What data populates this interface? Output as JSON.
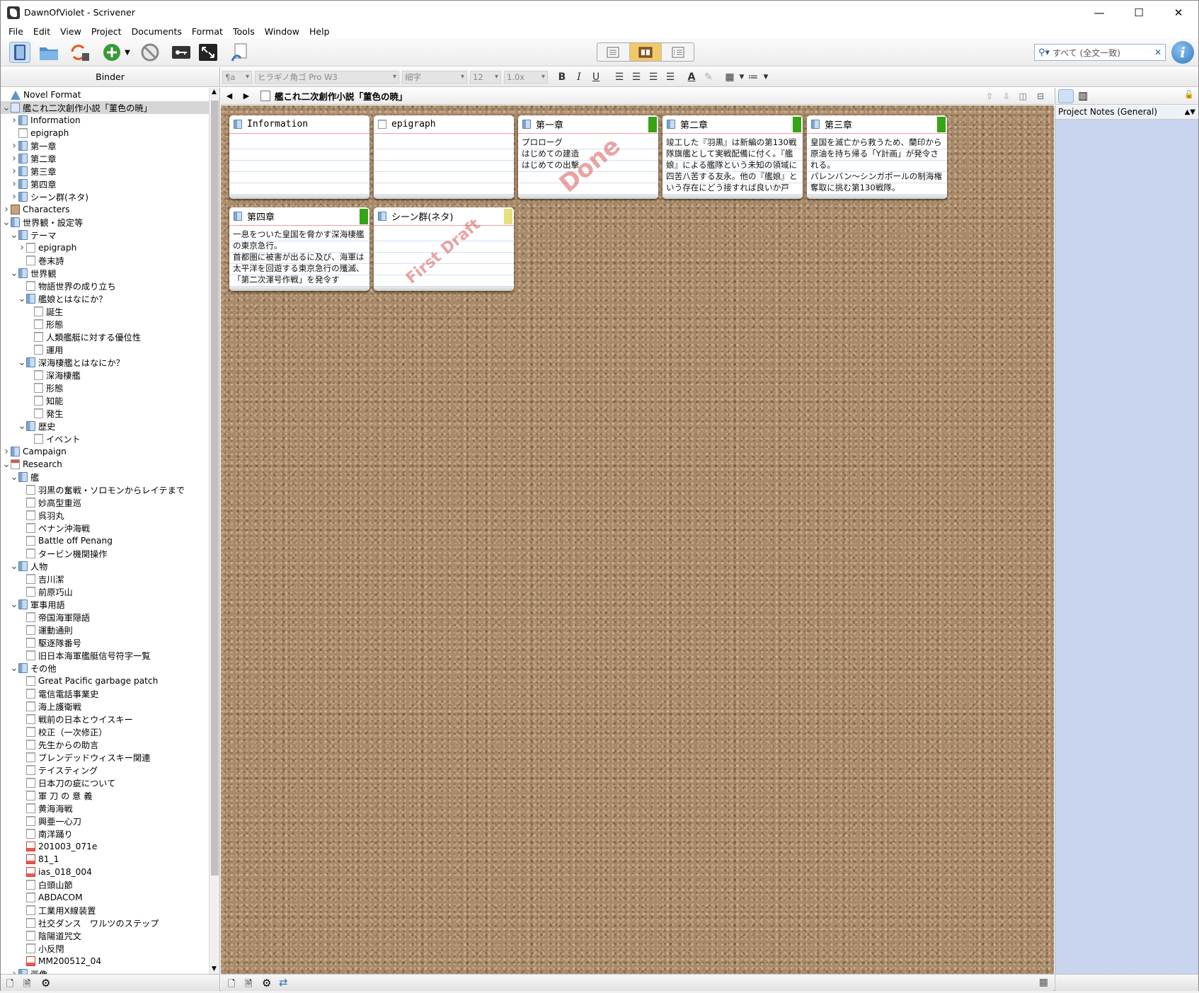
{
  "window": {
    "title": "DawnOfViolet - Scrivener",
    "minimize": "—",
    "maximize": "☐",
    "close": "✕"
  },
  "menu": [
    "File",
    "Edit",
    "View",
    "Project",
    "Documents",
    "Format",
    "Tools",
    "Window",
    "Help"
  ],
  "toolbar": {
    "search_placeholder": "すべて (全文一致)",
    "info": "i"
  },
  "binder": {
    "header": "Binder",
    "items": [
      {
        "label": "Novel Format",
        "level": 0,
        "icon": "warn",
        "arrow": ""
      },
      {
        "label": "艦これ二次創作小説「菫色の暁」",
        "level": 0,
        "icon": "draft",
        "arrow": "v",
        "selected": true
      },
      {
        "label": "Information",
        "level": 1,
        "icon": "folder",
        "arrow": ">"
      },
      {
        "label": "epigraph",
        "level": 1,
        "icon": "doc",
        "arrow": ""
      },
      {
        "label": "第一章",
        "level": 1,
        "icon": "folder",
        "arrow": ">"
      },
      {
        "label": "第二章",
        "level": 1,
        "icon": "folder",
        "arrow": ">"
      },
      {
        "label": "第三章",
        "level": 1,
        "icon": "folder",
        "arrow": ">"
      },
      {
        "label": "第四章",
        "level": 1,
        "icon": "folder",
        "arrow": ">"
      },
      {
        "label": "シーン群(ネタ)",
        "level": 1,
        "icon": "folder",
        "arrow": ">"
      },
      {
        "label": "Characters",
        "level": 0,
        "icon": "chars",
        "arrow": ">"
      },
      {
        "label": "世界観・設定等",
        "level": 0,
        "icon": "folder",
        "arrow": "v"
      },
      {
        "label": "テーマ",
        "level": 1,
        "icon": "folder",
        "arrow": "v"
      },
      {
        "label": "epigraph",
        "level": 2,
        "icon": "doc",
        "arrow": ">"
      },
      {
        "label": "巻末詩",
        "level": 2,
        "icon": "doc",
        "arrow": ""
      },
      {
        "label": "世界観",
        "level": 1,
        "icon": "folder",
        "arrow": "v"
      },
      {
        "label": "物語世界の成り立ち",
        "level": 2,
        "icon": "doc",
        "arrow": ""
      },
      {
        "label": "艦娘とはなにか？",
        "level": 2,
        "icon": "folder",
        "arrow": "v"
      },
      {
        "label": "誕生",
        "level": 3,
        "icon": "doc",
        "arrow": ""
      },
      {
        "label": "形態",
        "level": 3,
        "icon": "doc",
        "arrow": ""
      },
      {
        "label": "人類艦艇に対する優位性",
        "level": 3,
        "icon": "doc",
        "arrow": ""
      },
      {
        "label": "運用",
        "level": 3,
        "icon": "doc",
        "arrow": ""
      },
      {
        "label": "深海棲艦とはなにか？",
        "level": 2,
        "icon": "folder",
        "arrow": "v"
      },
      {
        "label": "深海棲艦",
        "level": 3,
        "icon": "doc",
        "arrow": ""
      },
      {
        "label": "形態",
        "level": 3,
        "icon": "doc",
        "arrow": ""
      },
      {
        "label": "知能",
        "level": 3,
        "icon": "doc",
        "arrow": ""
      },
      {
        "label": "発生",
        "level": 3,
        "icon": "doc",
        "arrow": ""
      },
      {
        "label": "歴史",
        "level": 2,
        "icon": "folder",
        "arrow": "v"
      },
      {
        "label": "イベント",
        "level": 3,
        "icon": "doc",
        "arrow": ""
      },
      {
        "label": "Campaign",
        "level": 0,
        "icon": "folder",
        "arrow": ">"
      },
      {
        "label": "Research",
        "level": 0,
        "icon": "research",
        "arrow": "v"
      },
      {
        "label": "艦",
        "level": 1,
        "icon": "folder",
        "arrow": "v"
      },
      {
        "label": "羽黒の奮戦・ソロモンからレイテまで",
        "level": 2,
        "icon": "doc",
        "arrow": ""
      },
      {
        "label": "妙高型重巡",
        "level": 2,
        "icon": "doc",
        "arrow": ""
      },
      {
        "label": "呉羽丸",
        "level": 2,
        "icon": "doc",
        "arrow": ""
      },
      {
        "label": "ペナン沖海戦",
        "level": 2,
        "icon": "doc",
        "arrow": ""
      },
      {
        "label": "Battle off Penang",
        "level": 2,
        "icon": "doc",
        "arrow": ""
      },
      {
        "label": "タービン機関操作",
        "level": 2,
        "icon": "doc",
        "arrow": ""
      },
      {
        "label": "人物",
        "level": 1,
        "icon": "folder",
        "arrow": "v"
      },
      {
        "label": "吉川潔",
        "level": 2,
        "icon": "doc",
        "arrow": ""
      },
      {
        "label": "前原巧山",
        "level": 2,
        "icon": "doc",
        "arrow": ""
      },
      {
        "label": "軍事用語",
        "level": 1,
        "icon": "folder",
        "arrow": "v"
      },
      {
        "label": "帝国海軍隠語",
        "level": 2,
        "icon": "doc",
        "arrow": ""
      },
      {
        "label": "運動通則",
        "level": 2,
        "icon": "doc",
        "arrow": ""
      },
      {
        "label": "駆逐隊番号",
        "level": 2,
        "icon": "doc",
        "arrow": ""
      },
      {
        "label": "旧日本海軍艦艇信号符字一覧",
        "level": 2,
        "icon": "doc",
        "arrow": ""
      },
      {
        "label": "その他",
        "level": 1,
        "icon": "folder",
        "arrow": "v"
      },
      {
        "label": "Great Pacific garbage patch",
        "level": 2,
        "icon": "doc",
        "arrow": ""
      },
      {
        "label": "電信電話事業史",
        "level": 2,
        "icon": "doc",
        "arrow": ""
      },
      {
        "label": "海上護衛戦",
        "level": 2,
        "icon": "doc",
        "arrow": ""
      },
      {
        "label": "戦前の日本とウイスキー",
        "level": 2,
        "icon": "doc",
        "arrow": ""
      },
      {
        "label": "校正（一次修正）",
        "level": 2,
        "icon": "doc",
        "arrow": ""
      },
      {
        "label": "先生からの助言",
        "level": 2,
        "icon": "doc",
        "arrow": ""
      },
      {
        "label": "ブレンデッドウィスキー関連",
        "level": 2,
        "icon": "doc",
        "arrow": ""
      },
      {
        "label": "テイスティング",
        "level": 2,
        "icon": "doc",
        "arrow": ""
      },
      {
        "label": "日本刀の疵について",
        "level": 2,
        "icon": "doc",
        "arrow": ""
      },
      {
        "label": "軍 刀 の 意 義",
        "level": 2,
        "icon": "doc",
        "arrow": ""
      },
      {
        "label": "黄海海戦",
        "level": 2,
        "icon": "doc",
        "arrow": ""
      },
      {
        "label": "興亜一心刀",
        "level": 2,
        "icon": "doc",
        "arrow": ""
      },
      {
        "label": "南洋踊り",
        "level": 2,
        "icon": "doc",
        "arrow": ""
      },
      {
        "label": "201003_071e",
        "level": 2,
        "icon": "pdf",
        "arrow": ""
      },
      {
        "label": "81_1",
        "level": 2,
        "icon": "pdf",
        "arrow": ""
      },
      {
        "label": "ias_018_004",
        "level": 2,
        "icon": "pdf",
        "arrow": ""
      },
      {
        "label": "白頭山節",
        "level": 2,
        "icon": "doc",
        "arrow": ""
      },
      {
        "label": "ABDACOM",
        "level": 2,
        "icon": "doc",
        "arrow": ""
      },
      {
        "label": "工業用X線装置",
        "level": 2,
        "icon": "doc",
        "arrow": ""
      },
      {
        "label": "社交ダンス　ワルツのステップ",
        "level": 2,
        "icon": "doc",
        "arrow": ""
      },
      {
        "label": "陰陽道咒文",
        "level": 2,
        "icon": "doc",
        "arrow": ""
      },
      {
        "label": "小反閇",
        "level": 2,
        "icon": "doc",
        "arrow": ""
      },
      {
        "label": "MM200512_04",
        "level": 2,
        "icon": "pdf",
        "arrow": ""
      },
      {
        "label": "画像",
        "level": 1,
        "icon": "folder",
        "arrow": ">"
      }
    ]
  },
  "format": {
    "style": "¶a",
    "font": "ヒラギノ角ゴ Pro W3",
    "weight": "細字",
    "size": "12",
    "spacing": "1.0x",
    "bold": "B",
    "italic": "I",
    "underline": "U"
  },
  "editor": {
    "doc_title": "艦これ二次創作小説「菫色の暁」",
    "back": "◀",
    "forward": "▶",
    "cards": [
      {
        "title": "Information",
        "mono": true,
        "label_color": "",
        "synopsis": "",
        "stamp": ""
      },
      {
        "title": "epigraph",
        "mono": true,
        "label_color": "",
        "synopsis": "",
        "stamp": "",
        "doc": true
      },
      {
        "title": "第一章",
        "label_color": "#34a515",
        "synopsis": "プロローグ\nはじめての建造\nはじめての出撃",
        "stamp": "Done"
      },
      {
        "title": "第二章",
        "label_color": "#34a515",
        "synopsis": "竣工した『羽黒』は新編の第130戦隊旗艦として実戦配備に付く。『艦娘』による艦隊という未知の領域に四苦八苦する友永。他の『艦娘』という存在にどう接すれば良いか戸",
        "stamp": ""
      },
      {
        "title": "第三章",
        "label_color": "#34a515",
        "synopsis": "皇国を滅亡から救うため、蘭印から原油を持ち帰る「Y計画」が発令される。\nパレンバン～シンガポールの制海権奪取に挑む第130戦隊。",
        "stamp": ""
      },
      {
        "title": "第四章",
        "label_color": "#34a515",
        "synopsis": "一息をついた皇国を脅かす深海棲艦の東京急行。\n首都圏に被害が出るに及び、海軍は太平洋を回遊する東京急行の殲滅、「第二次渾号作戦」を発令す",
        "stamp": ""
      },
      {
        "title": "シーン群(ネタ)",
        "label_color": "#e8e07a",
        "synopsis": "",
        "stamp": "First Draft"
      }
    ]
  },
  "inspector": {
    "title": "Project Notes (General)"
  }
}
